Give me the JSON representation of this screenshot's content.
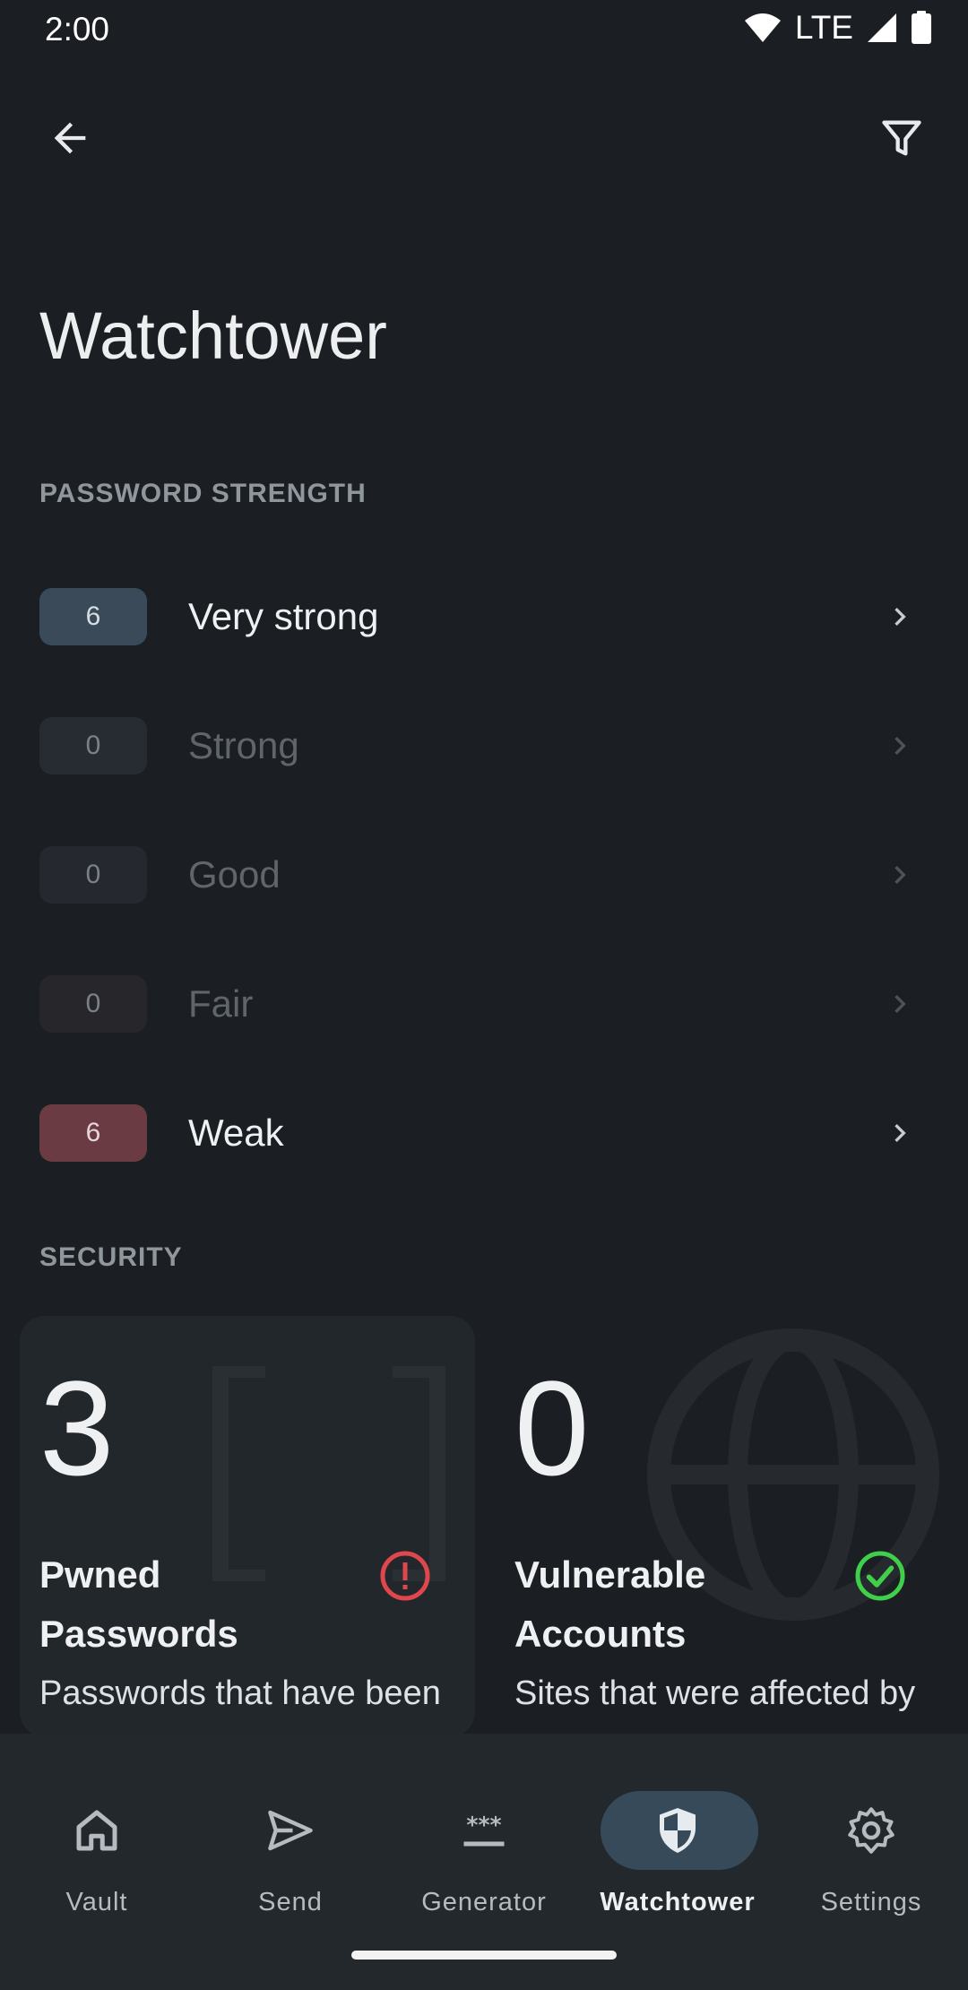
{
  "status_bar": {
    "time": "2:00",
    "network": "LTE"
  },
  "page": {
    "title": "Watchtower"
  },
  "password_strength": {
    "section_label": "PASSWORD STRENGTH",
    "rows": [
      {
        "count": "6",
        "label": "Very strong",
        "badge_color": "#3b4a58",
        "badge_text_color": "#d6dde3"
      },
      {
        "count": "0",
        "label": "Strong",
        "badge_color": "#262c32",
        "badge_text_color": "#7a8188"
      },
      {
        "count": "0",
        "label": "Good",
        "badge_color": "#25282e",
        "badge_text_color": "#7a8188"
      },
      {
        "count": "0",
        "label": "Fair",
        "badge_color": "#27262a",
        "badge_text_color": "#7a8188"
      },
      {
        "count": "6",
        "label": "Weak",
        "badge_color": "#6a3b42",
        "badge_text_color": "#e7d6d9"
      }
    ]
  },
  "security": {
    "section_label": "SECURITY",
    "cards": [
      {
        "count": "3",
        "title": "Pwned Passwords",
        "description": "Passwords that have been",
        "status_icon": "alert-circle-icon",
        "status_color": "#e0474c",
        "background_icon": "brackets-icon"
      },
      {
        "count": "0",
        "title": "Vulnerable Accounts",
        "description": "Sites that were affected by",
        "status_icon": "check-circle-icon",
        "status_color": "#3fcf4a",
        "background_icon": "globe-icon"
      }
    ]
  },
  "bottom_nav": {
    "items": [
      {
        "label": "Vault",
        "icon": "home-icon"
      },
      {
        "label": "Send",
        "icon": "send-icon"
      },
      {
        "label": "Generator",
        "icon": "asterisks-icon"
      },
      {
        "label": "Watchtower",
        "icon": "shield-icon",
        "active": true
      },
      {
        "label": "Settings",
        "icon": "gear-icon"
      }
    ]
  },
  "colors": {
    "background": "#1b1e22",
    "nav_background": "#23282d",
    "active_pill": "#374a5a",
    "section_label": "#8f969c"
  }
}
